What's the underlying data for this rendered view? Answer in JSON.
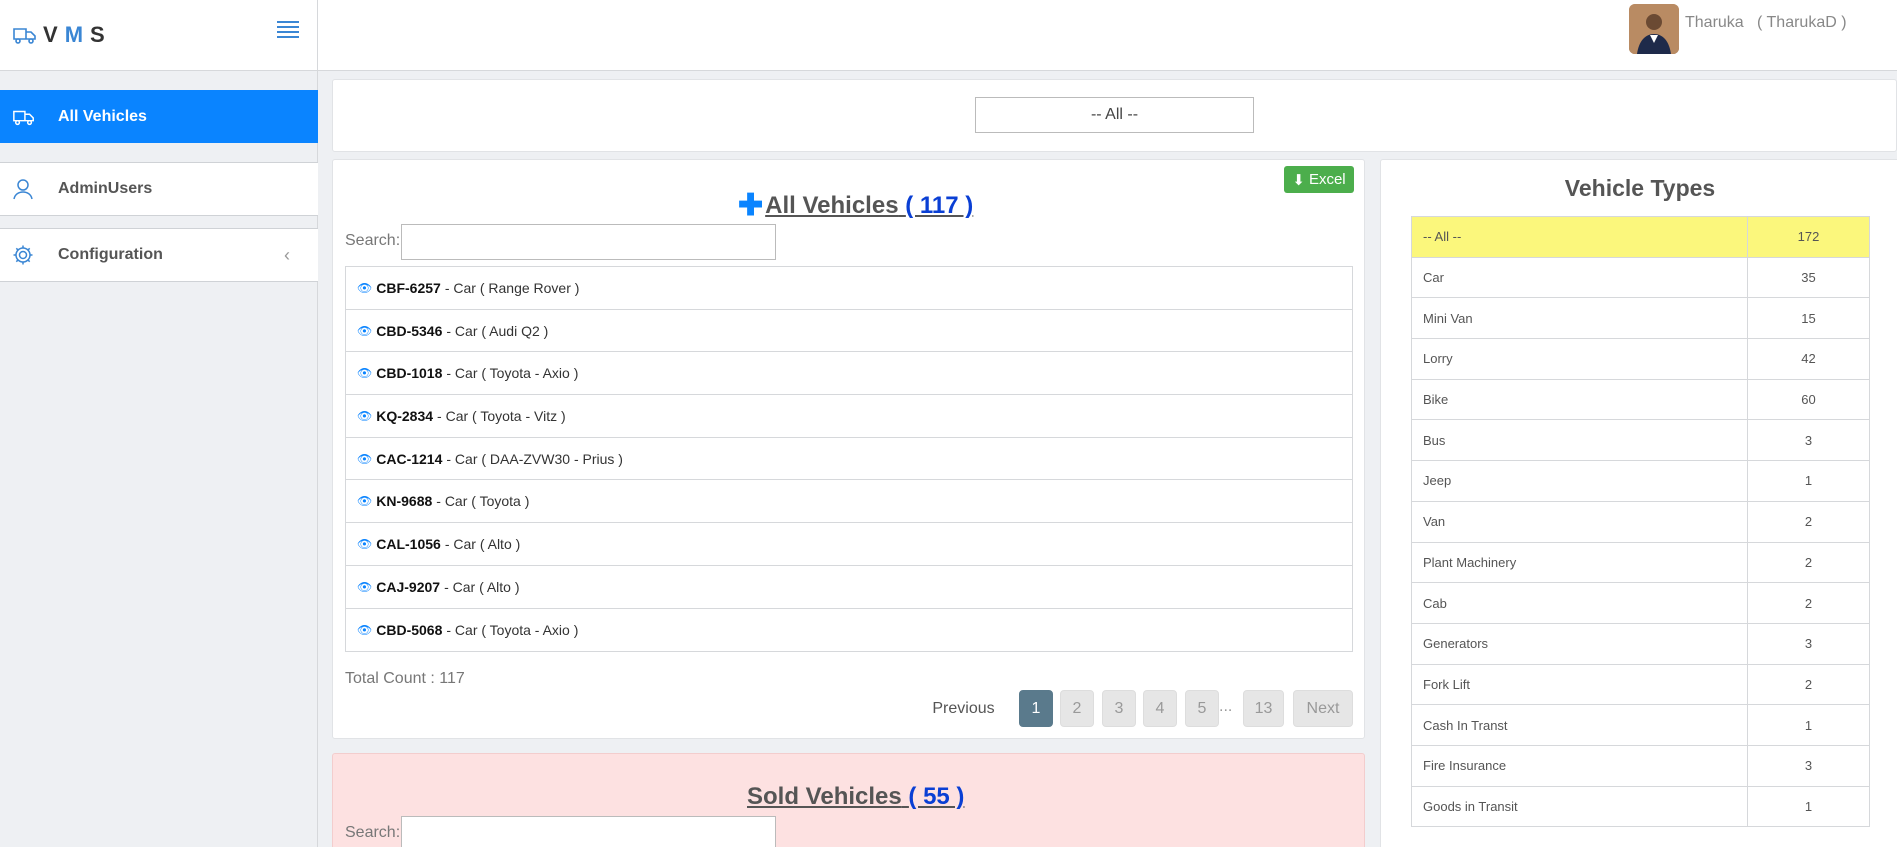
{
  "brand": {
    "letters": [
      "V",
      "M",
      "S"
    ]
  },
  "sidebar": {
    "items": [
      {
        "label": "All Vehicles",
        "icon": "truck-icon"
      },
      {
        "label": "AdminUsers",
        "icon": "user-icon"
      },
      {
        "label": "Configuration",
        "icon": "gear-icon"
      }
    ]
  },
  "user": {
    "display": "Tharuka   ( TharukaD )"
  },
  "filter": {
    "value": "-- All --"
  },
  "vehicles": {
    "title": "All Vehicles",
    "count": "( 117 )",
    "excel_label": "Excel",
    "search_label": "Search:",
    "list": [
      {
        "plate": "CBF-6257",
        "desc": "- Car ( Range Rover )"
      },
      {
        "plate": "CBD-5346",
        "desc": "- Car ( Audi Q2 )"
      },
      {
        "plate": "CBD-1018",
        "desc": "- Car ( Toyota - Axio )"
      },
      {
        "plate": "KQ-2834",
        "desc": "- Car ( Toyota - Vitz )"
      },
      {
        "plate": "CAC-1214",
        "desc": "- Car ( DAA-ZVW30 - Prius )"
      },
      {
        "plate": "KN-9688",
        "desc": "- Car ( Toyota )"
      },
      {
        "plate": "CAL-1056",
        "desc": "- Car ( Alto )"
      },
      {
        "plate": "CAJ-9207",
        "desc": "- Car ( Alto )"
      },
      {
        "plate": "CBD-5068",
        "desc": "- Car ( Toyota - Axio )"
      }
    ],
    "total": "Total Count : 117",
    "pagination": {
      "previous": "Previous",
      "pages": [
        "1",
        "2",
        "3",
        "4",
        "5"
      ],
      "ellipsis": "...",
      "last": "13",
      "next": "Next"
    }
  },
  "sold": {
    "title": "Sold Vehicles",
    "count": "( 55 )",
    "search_label": "Search:"
  },
  "types": {
    "title": "Vehicle Types",
    "rows": [
      {
        "name": "-- All --",
        "count": "172"
      },
      {
        "name": "Car",
        "count": "35"
      },
      {
        "name": "Mini Van",
        "count": "15"
      },
      {
        "name": "Lorry",
        "count": "42"
      },
      {
        "name": "Bike",
        "count": "60"
      },
      {
        "name": "Bus",
        "count": "3"
      },
      {
        "name": "Jeep",
        "count": "1"
      },
      {
        "name": "Van",
        "count": "2"
      },
      {
        "name": "Plant Machinery",
        "count": "2"
      },
      {
        "name": "Cab",
        "count": "2"
      },
      {
        "name": "Generators",
        "count": "3"
      },
      {
        "name": "Fork Lift",
        "count": "2"
      },
      {
        "name": "Cash In Transt",
        "count": "1"
      },
      {
        "name": "Fire Insurance",
        "count": "3"
      },
      {
        "name": "Goods in Transit",
        "count": "1"
      }
    ],
    "highlight_color": "#fbf77c"
  },
  "colors": {
    "accent": "#0a84ff",
    "excel": "#4cae4c",
    "sold_bg": "#fde1e1"
  }
}
